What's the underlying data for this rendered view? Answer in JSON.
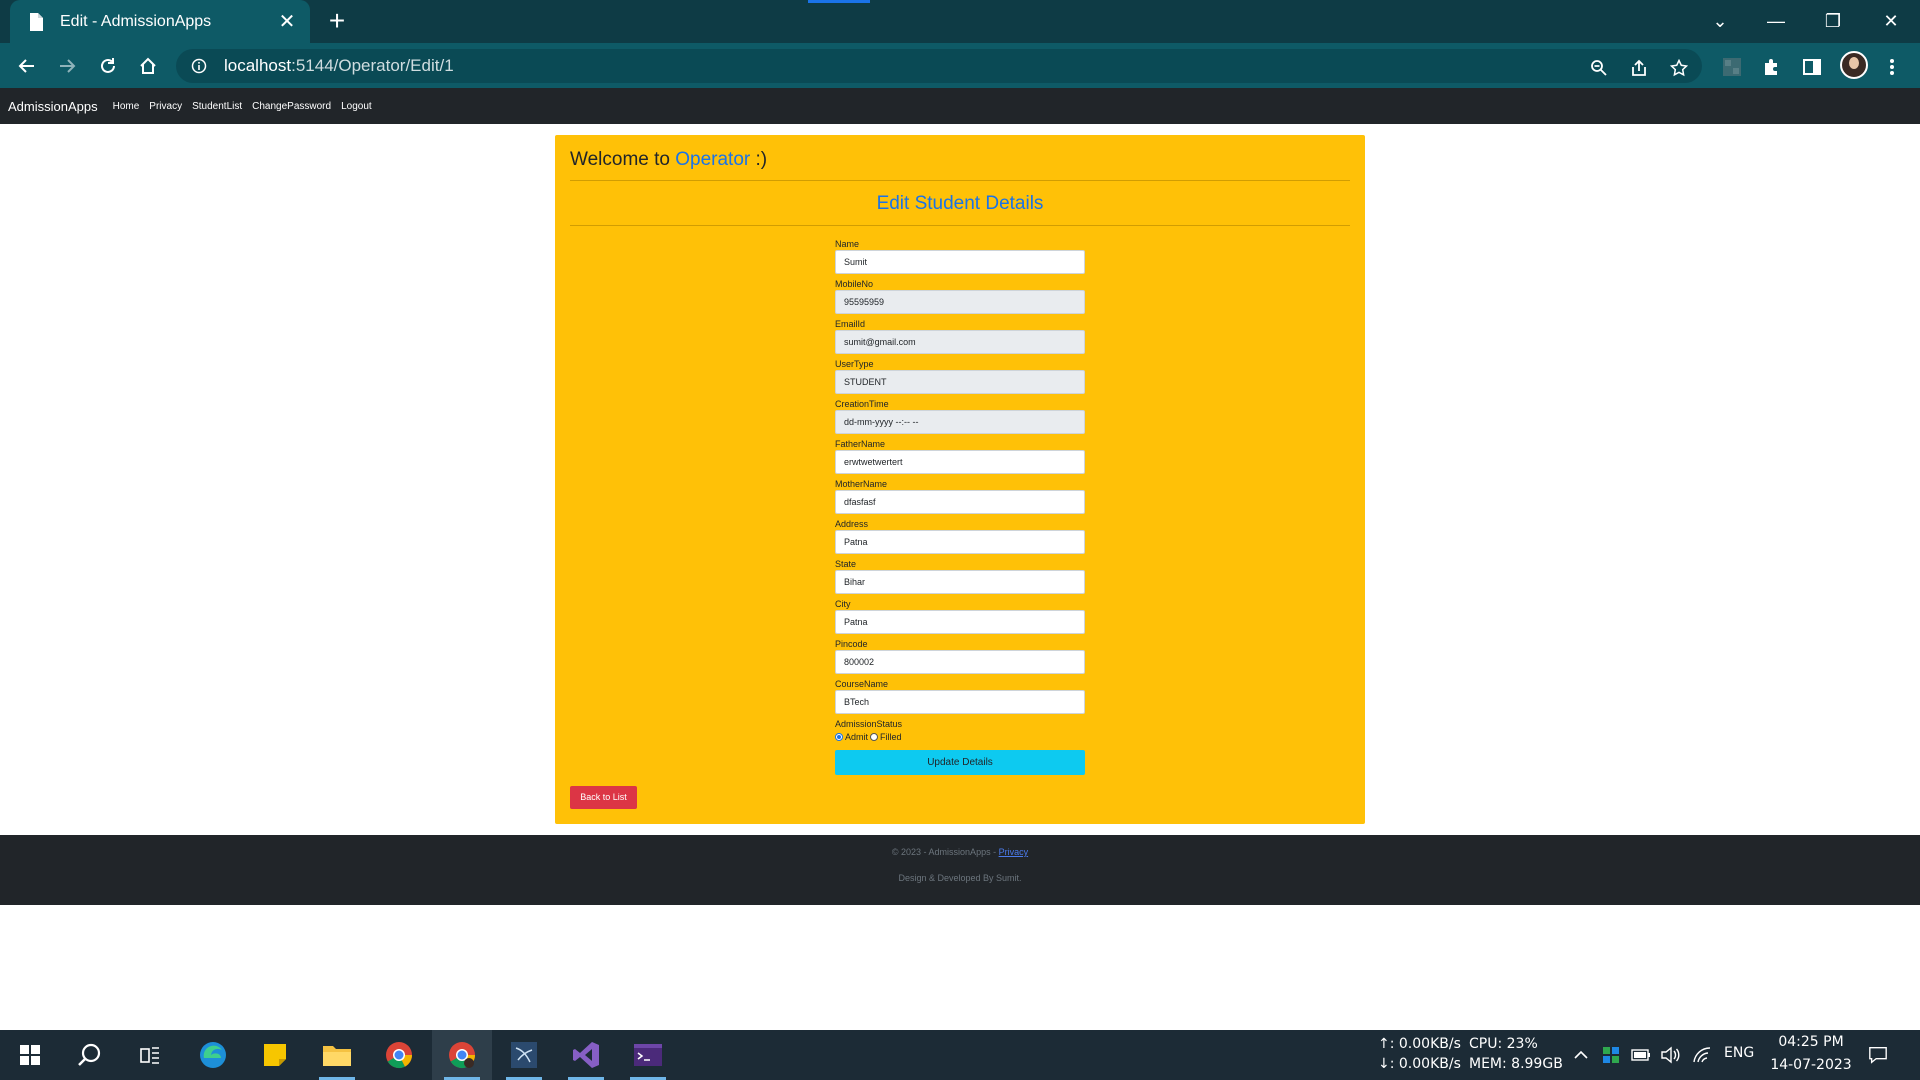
{
  "browser": {
    "tab_title": "Edit - AdmissionApps",
    "url_host": "localhost",
    "url_path": ":5144/Operator/Edit/1"
  },
  "site_nav": {
    "brand": "AdmissionApps",
    "links": [
      "Home",
      "Privacy",
      "StudentList",
      "ChangePassword",
      "Logout"
    ]
  },
  "card": {
    "welcome_prefix": "Welcome to",
    "welcome_role": "Operator",
    "welcome_suffix": ":)",
    "title": "Edit Student Details",
    "fields": [
      {
        "label": "Name",
        "value": "Sumit",
        "readonly": false
      },
      {
        "label": "MobileNo",
        "value": "95595959",
        "readonly": true
      },
      {
        "label": "EmailId",
        "value": "sumit@gmail.com",
        "readonly": true
      },
      {
        "label": "UserType",
        "value": "STUDENT",
        "readonly": true
      },
      {
        "label": "CreationTime",
        "value": "dd-mm-yyyy --:-- --",
        "readonly": true
      },
      {
        "label": "FatherName",
        "value": "erwtwetwertert",
        "readonly": false
      },
      {
        "label": "MotherName",
        "value": "dfasfasf",
        "readonly": false
      },
      {
        "label": "Address",
        "value": "Patna",
        "readonly": false
      },
      {
        "label": "State",
        "value": "Bihar",
        "readonly": false
      },
      {
        "label": "City",
        "value": "Patna",
        "readonly": false
      },
      {
        "label": "Pincode",
        "value": "800002",
        "readonly": false
      },
      {
        "label": "CourseName",
        "value": "BTech",
        "readonly": false
      }
    ],
    "admission_status": {
      "label": "AdmissionStatus",
      "options": [
        "Admit",
        "Filled"
      ],
      "selected": "Admit"
    },
    "update_button": "Update Details",
    "back_button": "Back to List"
  },
  "footer": {
    "copyright": "© 2023 - AdmissionApps -",
    "privacy_link": "Privacy",
    "credit": "Design & Developed By Sumit."
  },
  "taskbar": {
    "net_up": "↑: 0.00KB/s",
    "net_down": "↓: 0.00KB/s",
    "cpu": "CPU: 23%",
    "mem": "MEM: 8.99GB",
    "lang": "ENG",
    "time": "04:25 PM",
    "date": "14-07-2023"
  },
  "colors": {
    "card_bg": "#ffc107",
    "accent_blue": "#1a73e8",
    "update_btn": "#0dcaf0",
    "back_btn": "#dc3545",
    "navbar": "#212529",
    "chrome": "#0e5a66"
  }
}
